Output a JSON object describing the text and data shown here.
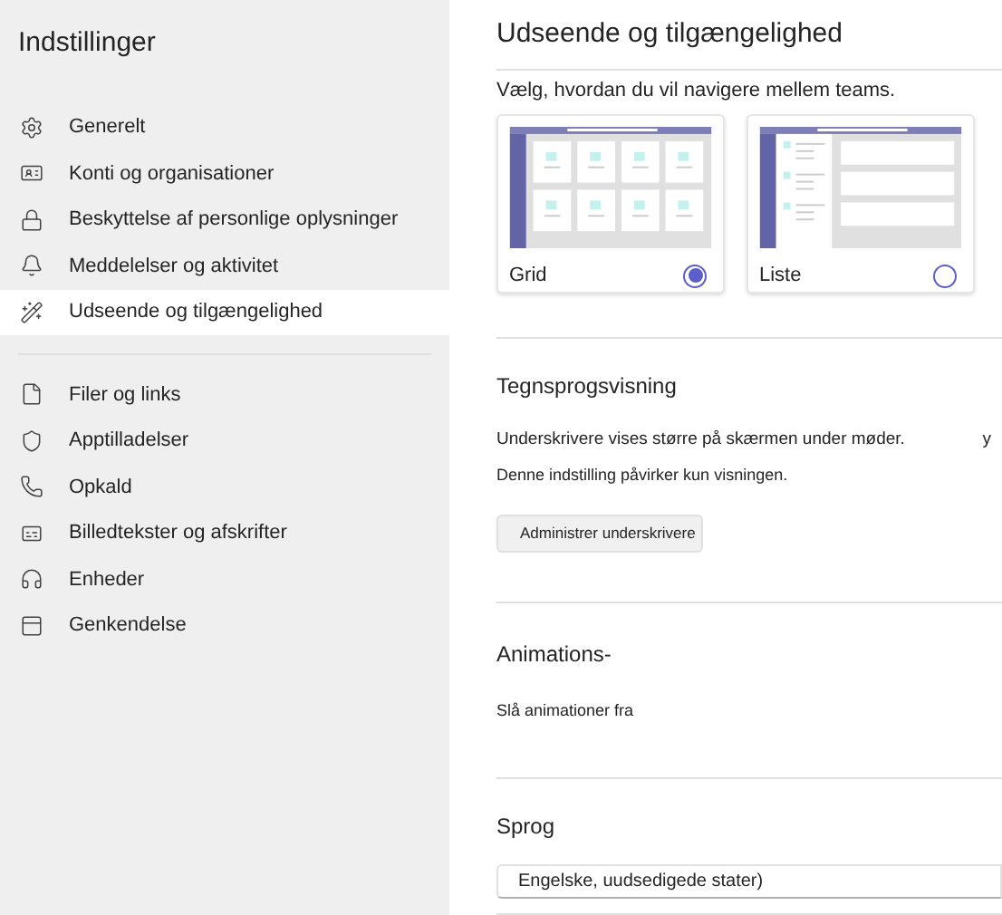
{
  "sidebar": {
    "title": "Indstillinger",
    "groups": [
      {
        "items": [
          {
            "label": "Generelt",
            "selected": false
          },
          {
            "label": "Konti og organisationer",
            "selected": false
          },
          {
            "label": "Beskyttelse af personlige oplysninger",
            "selected": false
          },
          {
            "label": "Meddelelser og aktivitet",
            "selected": false
          },
          {
            "label": "Udseende og tilgængelighed",
            "selected": true
          }
        ]
      },
      {
        "items": [
          {
            "label": "Filer og links",
            "selected": false
          },
          {
            "label": "Apptilladelser",
            "selected": false
          },
          {
            "label": "Opkald",
            "selected": false
          },
          {
            "label": "Billedtekster og afskrifter",
            "selected": false
          },
          {
            "label": "Enheder",
            "selected": false
          },
          {
            "label": "Genkendelse",
            "selected": false
          }
        ]
      }
    ]
  },
  "main": {
    "title": "Udseende og tilgængelighed",
    "navigation": {
      "description": "Vælg, hvordan du vil navigere mellem teams.",
      "options": [
        {
          "label": "Grid",
          "kind": "grid",
          "selected": true
        },
        {
          "label": "Liste",
          "kind": "list",
          "selected": false
        }
      ]
    },
    "sign_language": {
      "heading": "Tegnsprogsvisning",
      "description": "Underskrivere vises større på skærmen under møder.",
      "cut_text": "y",
      "note": "Denne indstilling påvirker kun visningen.",
      "button": "Administrer underskrivere"
    },
    "animations": {
      "heading": "Animations-",
      "label": "Slå animationer fra"
    },
    "language": {
      "heading": "Sprog",
      "value": "Engelske, uudsedigede stater)"
    }
  }
}
